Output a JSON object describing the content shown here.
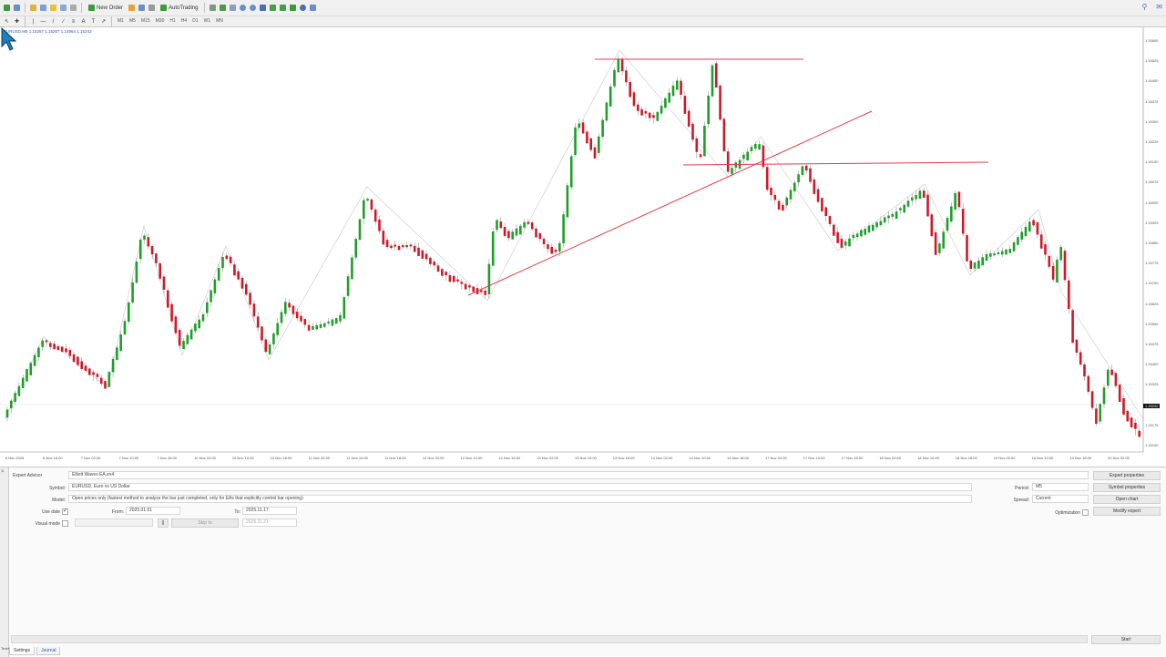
{
  "toolbar": {
    "new_order": "New Order",
    "autotrading": "AutoTrading",
    "timeframes": [
      "M1",
      "M5",
      "M15",
      "M30",
      "H1",
      "H4",
      "D1",
      "W1",
      "MN"
    ]
  },
  "chart": {
    "info": "EURUSD,M5  1.15257 1.15267 1.14964 1.15242",
    "current_price": "1.15242",
    "price_labels": [
      "1.16600",
      "1.16525",
      "1.16450",
      "1.16375",
      "1.16300",
      "1.16225",
      "1.16150",
      "1.16075",
      "1.16000",
      "1.15925",
      "1.15850",
      "1.15775",
      "1.15700",
      "1.15625",
      "1.15550",
      "1.15475",
      "1.15400",
      "1.15325",
      "1.15250",
      "1.15175",
      "1.15100"
    ],
    "time_labels": [
      "6 Nov 2025",
      "6 Nov 18:00",
      "7 Nov 02:00",
      "7 Nov 10:00",
      "7 Nov 18:00",
      "10 Nov 02:00",
      "10 Nov 10:00",
      "10 Nov 18:00",
      "11 Nov 02:00",
      "11 Nov 10:00",
      "11 Nov 18:00",
      "12 Nov 02:00",
      "12 Nov 10:00",
      "12 Nov 18:00",
      "13 Nov 02:00",
      "13 Nov 10:00",
      "13 Nov 18:00",
      "14 Nov 02:00",
      "14 Nov 10:00",
      "14 Nov 18:00",
      "17 Nov 02:00",
      "17 Nov 10:00",
      "17 Nov 18:00",
      "18 Nov 02:00",
      "18 Nov 10:00",
      "18 Nov 18:00",
      "19 Nov 02:00",
      "19 Nov 10:00",
      "19 Nov 18:00",
      "20 Nov 02:00"
    ],
    "colors": {
      "bull": "#1e9e2a",
      "bear": "#d0182a",
      "trendline": "#e23d4e",
      "zigzag": "#c8c8c8"
    }
  },
  "tester": {
    "expert_label": "Expert Advisor",
    "expert_value": "Elliott Waves EA.ex4",
    "symbol_label": "Symbol:",
    "symbol_value": "EURUSD, Euro vs US Dollar",
    "model_label": "Model:",
    "model_value": "Open prices only (fastest method to analyze the bar just completed, only for EAs that explicitly control bar opening)",
    "use_date_label": "Use date",
    "use_date_checked": true,
    "from_label": "From:",
    "from_value": "2025.01.01",
    "to_label": "To:",
    "to_value": "2025.11.17",
    "visual_mode_label": "Visual mode",
    "skip_to_label": "Skip to",
    "skip_to_value": "2025.11.21",
    "period_label": "Period:",
    "period_value": "M5",
    "spread_label": "Spread:",
    "spread_value": "Current",
    "optimization_label": "Optimization",
    "buttons": {
      "expert_properties": "Expert properties",
      "symbol_properties": "Symbol properties",
      "open_chart": "Open chart",
      "modify_expert": "Modify expert",
      "start": "Start"
    },
    "tabs": [
      "Settings",
      "Journal"
    ],
    "side_label": "Tester"
  }
}
